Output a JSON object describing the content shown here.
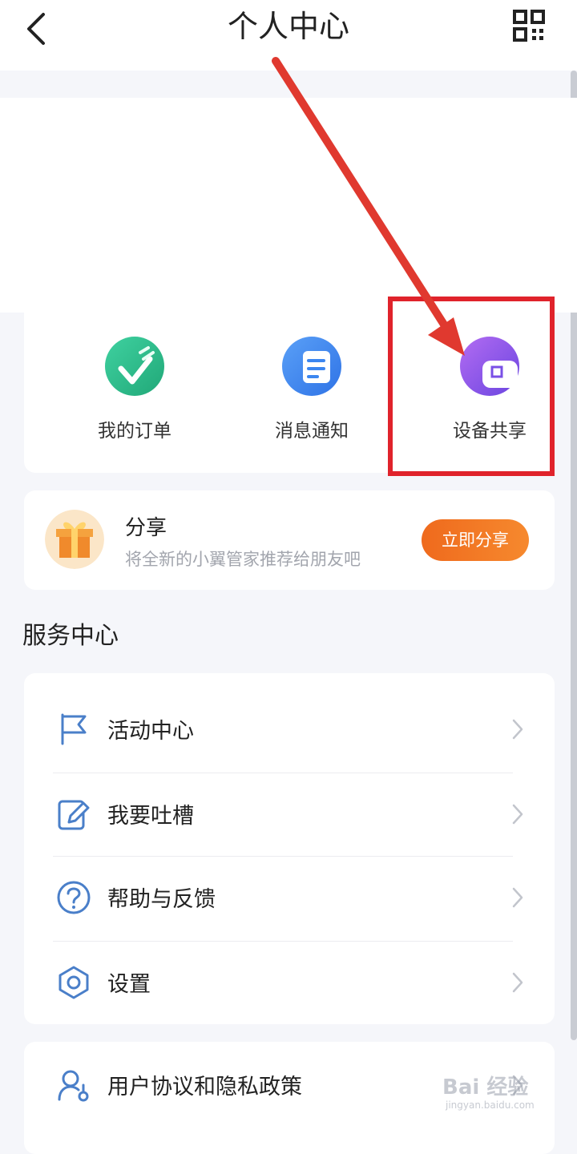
{
  "header": {
    "title": "个人中心",
    "back_icon": "chevron-left-icon",
    "qr_icon": "qr-code-icon"
  },
  "shortcuts": [
    {
      "label": "我的订单",
      "icon": "order-icon",
      "color": "#2fbf8f"
    },
    {
      "label": "消息通知",
      "icon": "message-icon",
      "color": "#3b86f0"
    },
    {
      "label": "设备共享",
      "icon": "device-share-icon",
      "color": "#8f5cf0"
    }
  ],
  "share": {
    "title": "分享",
    "subtitle": "将全新的小翼管家推荐给朋友吧",
    "button": "立即分享",
    "icon": "gift-icon"
  },
  "service": {
    "title": "服务中心",
    "items": [
      {
        "label": "活动中心",
        "icon": "flag-icon"
      },
      {
        "label": "我要吐槽",
        "icon": "edit-note-icon"
      },
      {
        "label": "帮助与反馈",
        "icon": "help-icon"
      },
      {
        "label": "设置",
        "icon": "settings-hexagon-icon"
      }
    ]
  },
  "policy": {
    "items": [
      {
        "label": "用户协议和隐私政策",
        "icon": "user-policy-icon"
      }
    ]
  },
  "annotation": {
    "highlight_color": "#e0232b"
  },
  "watermark": {
    "text": "Bai 经验",
    "url": "jingyan.baidu.com"
  }
}
